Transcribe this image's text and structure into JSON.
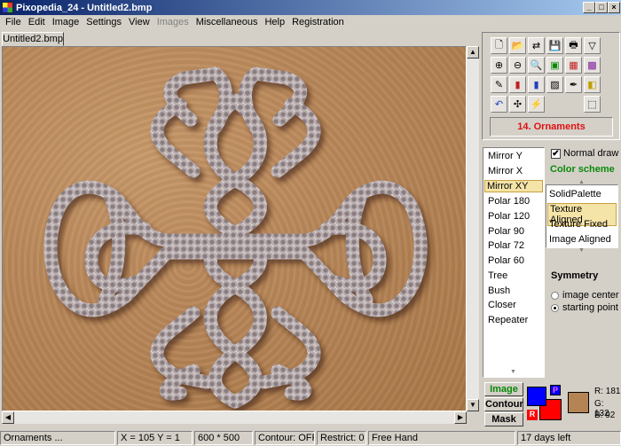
{
  "window": {
    "title": "Pixopedia_24  -  Untitled2.bmp",
    "min": "_",
    "max": "□",
    "close": "×"
  },
  "menu": [
    "File",
    "Edit",
    "Image",
    "Settings",
    "View",
    "Images",
    "Miscellaneous",
    "Help",
    "Registration"
  ],
  "tab": {
    "label": "Untitled2.bmp"
  },
  "tools": [
    "new-icon",
    "open-icon",
    "revert-icon",
    "save-icon",
    "print-icon",
    "funnel-icon",
    "zoom-in-icon",
    "zoom-out-icon",
    "zoom-fit-icon",
    "image-view-icon",
    "grid-icon",
    "palette-grid-icon",
    "brush-icon",
    "histogram-icon",
    "channels-icon",
    "photo-icon",
    "dropper-icon",
    "layers-icon",
    "undo-icon",
    "magic-icon",
    "wand-icon",
    "selection-icon"
  ],
  "ornament": {
    "label": "14. Ornaments"
  },
  "symmetry_list": [
    "Mirror Y",
    "Mirror X",
    "Mirror XY",
    "Polar 180",
    "Polar 120",
    "Polar 90",
    "Polar 72",
    "Polar 60",
    "Tree",
    "Bush",
    "Closer",
    "Repeater"
  ],
  "symmetry_selected": "Mirror XY",
  "normal_draw": {
    "label": "Normal draw",
    "checked": "✔"
  },
  "color_scheme": {
    "label": "Color scheme",
    "items": [
      "SolidPalette",
      "Texture Aligned",
      "Texture Fixed",
      "Image Aligned"
    ],
    "selected": "Texture Aligned"
  },
  "symmetry": {
    "label": "Symmetry",
    "options": [
      "image center",
      "starting point"
    ],
    "selected": "starting point"
  },
  "modes": [
    "Image",
    "Contour",
    "Mask"
  ],
  "colors": {
    "p": "P",
    "r": "R",
    "fg": "#0000ff",
    "bg": "#ff0000",
    "swatch": "#b58454"
  },
  "rgb": {
    "r": "R: 181",
    "g": "G: 132",
    "b": "B: 92"
  },
  "status": {
    "mode": "Ornaments ...",
    "coords": "X = 105 Y = 1",
    "size": "600 * 500",
    "contour": "Contour: OFF",
    "restrict": "Restrict: 0",
    "tool": "Free Hand",
    "trial": "17 days left"
  }
}
